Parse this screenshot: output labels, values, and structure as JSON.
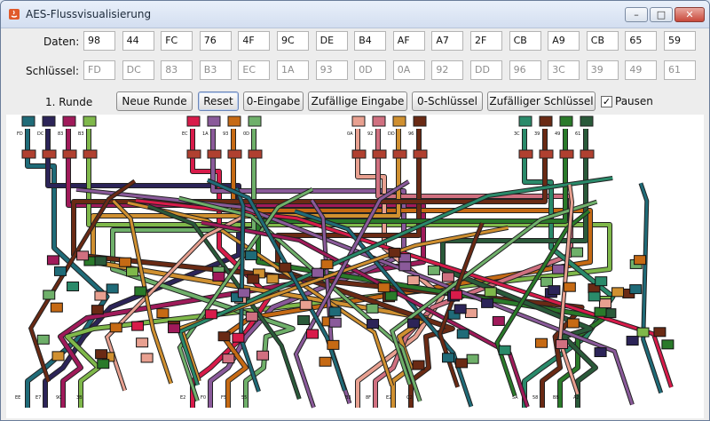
{
  "window": {
    "title": "AES-Flussvisualisierung",
    "minimize": "–",
    "maximize": "□",
    "close": "✕"
  },
  "labels": {
    "data": "Daten:",
    "key": "Schlüssel:",
    "round": "1. Runde",
    "pause": "Pausen"
  },
  "data_bytes": [
    "98",
    "44",
    "FC",
    "76",
    "4F",
    "9C",
    "DE",
    "B4",
    "AF",
    "A7",
    "2F",
    "CB",
    "A9",
    "CB",
    "65",
    "59"
  ],
  "key_bytes": [
    "FD",
    "DC",
    "83",
    "B3",
    "EC",
    "1A",
    "93",
    "0D",
    "0A",
    "92",
    "DD",
    "96",
    "3C",
    "39",
    "49",
    "61"
  ],
  "buttons": {
    "new_round": "Neue Runde",
    "reset": "Reset",
    "zero_input": "0-Eingabe",
    "random_input": "Zufällige Eingabe",
    "zero_key": "0-Schlüssel",
    "random_key": "Zufälliger Schlüssel"
  },
  "pause_checked": true,
  "viz": {
    "top_labels": [
      [
        "FD",
        "DC",
        "83",
        "B3"
      ],
      [
        "EC",
        "1A",
        "93",
        "0D"
      ],
      [
        "0A",
        "92",
        "DD",
        "96"
      ],
      [
        "3C",
        "39",
        "49",
        "61"
      ]
    ],
    "bottom_labels": [
      [
        "EE",
        "E7",
        "9C",
        "3B"
      ],
      [
        "E2",
        "F0",
        "F5",
        "55"
      ],
      [
        "B3",
        "8F",
        "E2",
        "C2"
      ],
      [
        "5A",
        "58",
        "BB",
        "A2"
      ]
    ],
    "colors": [
      "#1f6b78",
      "#2c2458",
      "#a01a5a",
      "#7fb84a",
      "#d81b4a",
      "#8a5a9a",
      "#c66a14",
      "#6fb06a",
      "#e8a090",
      "#d07080",
      "#d09030",
      "#6a2a14",
      "#2a8a6a",
      "#6a2a14",
      "#2a7a2a",
      "#2a5a3a"
    ]
  }
}
